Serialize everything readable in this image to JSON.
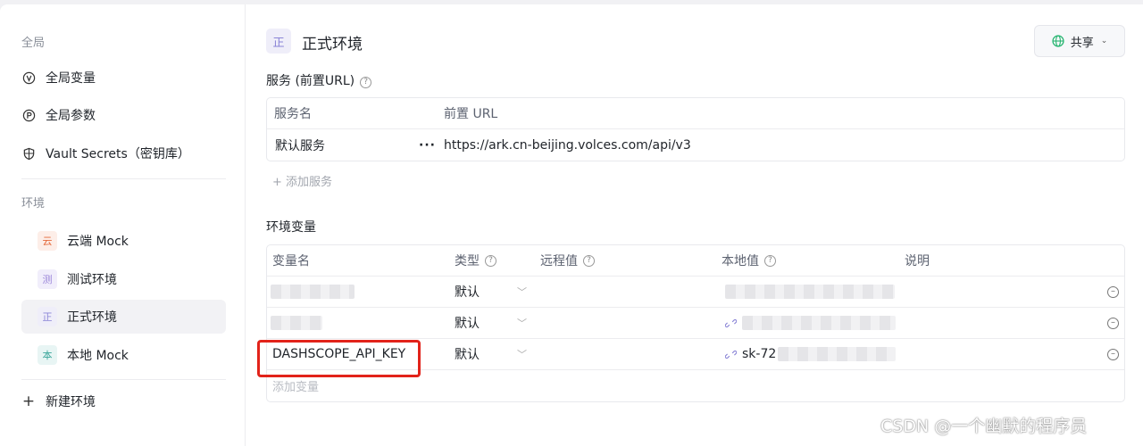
{
  "sidebar": {
    "global_label": "全局",
    "global_items": [
      {
        "label": "全局变量",
        "icon": "v-circle-icon"
      },
      {
        "label": "全局参数",
        "icon": "p-circle-icon"
      },
      {
        "label": "Vault Secrets（密钥库）",
        "icon": "shield-icon"
      }
    ],
    "env_label": "环境",
    "envs": [
      {
        "badge": "云",
        "label": "云端 Mock",
        "badge_bg": "#fdeee8",
        "badge_color": "#e4693a"
      },
      {
        "badge": "测",
        "label": "测试环境",
        "badge_bg": "#f1eefb",
        "badge_color": "#9b86d9"
      },
      {
        "badge": "正",
        "label": "正式环境",
        "badge_bg": "#efeef9",
        "badge_color": "#8a84d6"
      },
      {
        "badge": "本",
        "label": "本地 Mock",
        "badge_bg": "#e8f5f4",
        "badge_color": "#3aa69b"
      }
    ],
    "new_env": "新建环境"
  },
  "header": {
    "badge": "正",
    "title": "正式环境",
    "share": "共享"
  },
  "services": {
    "title": "服务 (前置URL)",
    "columns": [
      "服务名",
      "前置 URL"
    ],
    "rows": [
      {
        "name": "默认服务",
        "more": "···",
        "url": "https://ark.cn-beijing.volces.com/api/v3"
      }
    ],
    "add": "+ 添加服务"
  },
  "env_vars": {
    "title": "环境变量",
    "columns": [
      "变量名",
      "类型",
      "远程值",
      "本地值",
      "说明"
    ],
    "rows": [
      {
        "name": "",
        "type": "默认",
        "local_prefix": ""
      },
      {
        "name": "",
        "type": "默认",
        "local_prefix": ""
      },
      {
        "name": "DASHSCOPE_API_KEY",
        "type": "默认",
        "local_prefix": "sk-72"
      }
    ],
    "add_placeholder": "添加变量"
  },
  "watermark": "CSDN @一个幽默的程序员",
  "colors": {
    "accent": "#e2231a",
    "share_icon": "#2bb673"
  }
}
